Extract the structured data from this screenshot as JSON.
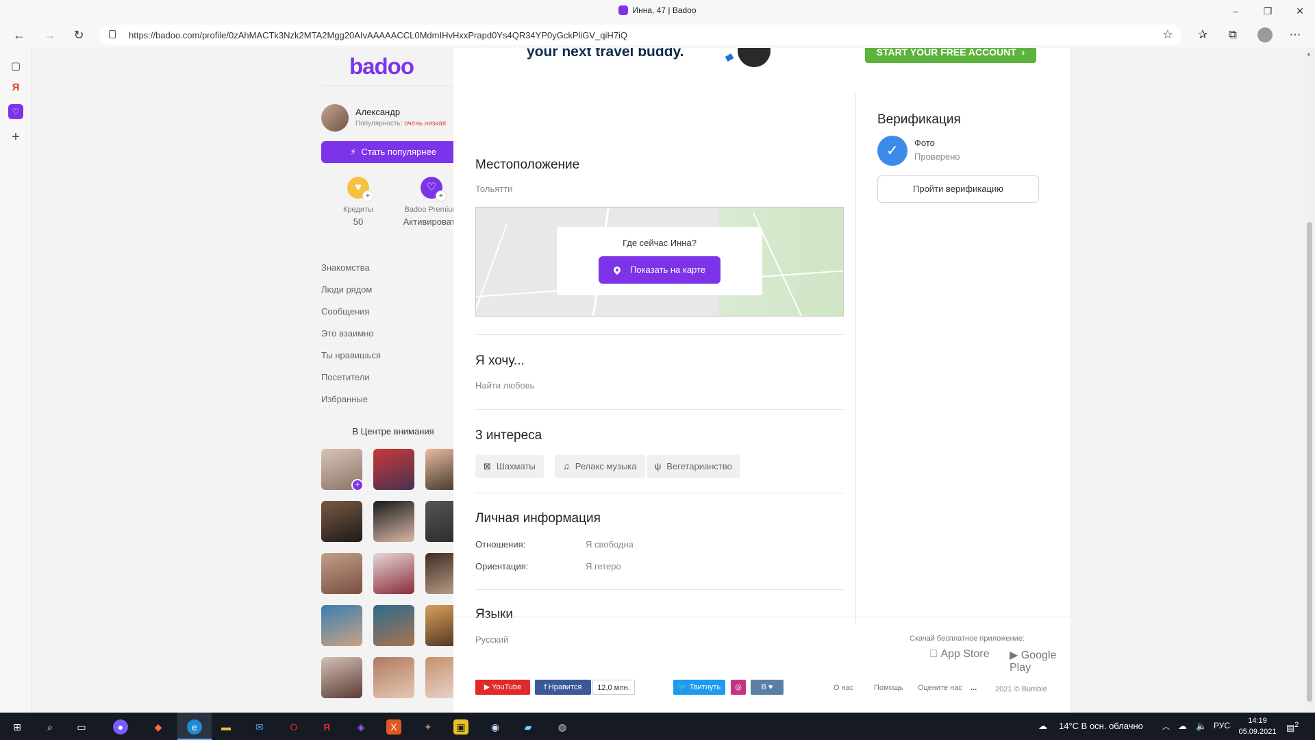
{
  "browser": {
    "tab_title": "Инна, 47 | Badoo",
    "url": "https://badoo.com/profile/0zAhMACTk3Nzk2MTA2Mgg20AIvAAAAACCL0MdmIHvHxxPrapd0Ys4QR34YP0yGckPliGV_qiH7iQ"
  },
  "sidebar": {
    "logo": "badoo",
    "user_name": "Александр",
    "popularity_label": "Популярность:",
    "popularity_value": "очень низкая",
    "popular_button": "Стать популярнее",
    "credits_label": "Кредиты",
    "credits_value": "50",
    "premium_label": "Badoo Premium",
    "premium_action": "Активировать",
    "nav": [
      "Знакомства",
      "Люди рядом",
      "Сообщения",
      "Это взаимно",
      "Ты нравишься",
      "Посетители",
      "Избранные"
    ],
    "spotlight_title": "В Центре внимания"
  },
  "banner": {
    "text": "your next travel buddy.",
    "cta": "START YOUR FREE ACCOUNT"
  },
  "profile": {
    "location_title": "Местоположение",
    "location_city": "Тольятти",
    "map_question": "Где сейчас Инна?",
    "map_button": "Показать на карте",
    "want_title": "Я хочу...",
    "want_value": "Найти любовь",
    "interests_title": "3 интереса",
    "interests": [
      "Шахматы",
      "Релакс музыка",
      "Вегетарианство"
    ],
    "personal_title": "Личная информация",
    "relationship_key": "Отношения:",
    "relationship_val": "Я свободна",
    "orientation_key": "Ориентация:",
    "orientation_val": "Я гетеро",
    "languages_title": "Языки",
    "languages_val": "Русский"
  },
  "verification": {
    "title": "Верификация",
    "photo_label": "Фото",
    "photo_status": "Проверено",
    "button": "Пройти верификацию"
  },
  "footer": {
    "download_text": "Скачай бесплатное приложение:",
    "app_store": "App Store",
    "google_play": "Google Play",
    "youtube": "YouTube",
    "fb_like": "Нравится",
    "fb_count": "12,0 млн.",
    "tweet": "Твитнуть",
    "vk": "В",
    "links": [
      "О нас",
      "Помощь",
      "Оцените нас"
    ],
    "more": "...",
    "copyright": "2021 © Bumble"
  },
  "taskbar": {
    "weather": "14°C  В осн. облачно",
    "lang": "РУС",
    "time": "14:19",
    "date": "05.09.2021",
    "notifications": "2"
  },
  "colors": {
    "brand": "#7d34e8",
    "cta_green": "#5db33d",
    "verify_blue": "#3d8be8",
    "taskbar": "#151a23"
  },
  "icons": {
    "bolt": "⚡",
    "interest_chess": "⊠",
    "interest_music": "♫",
    "interest_food": "ψ",
    "check": "✓"
  }
}
